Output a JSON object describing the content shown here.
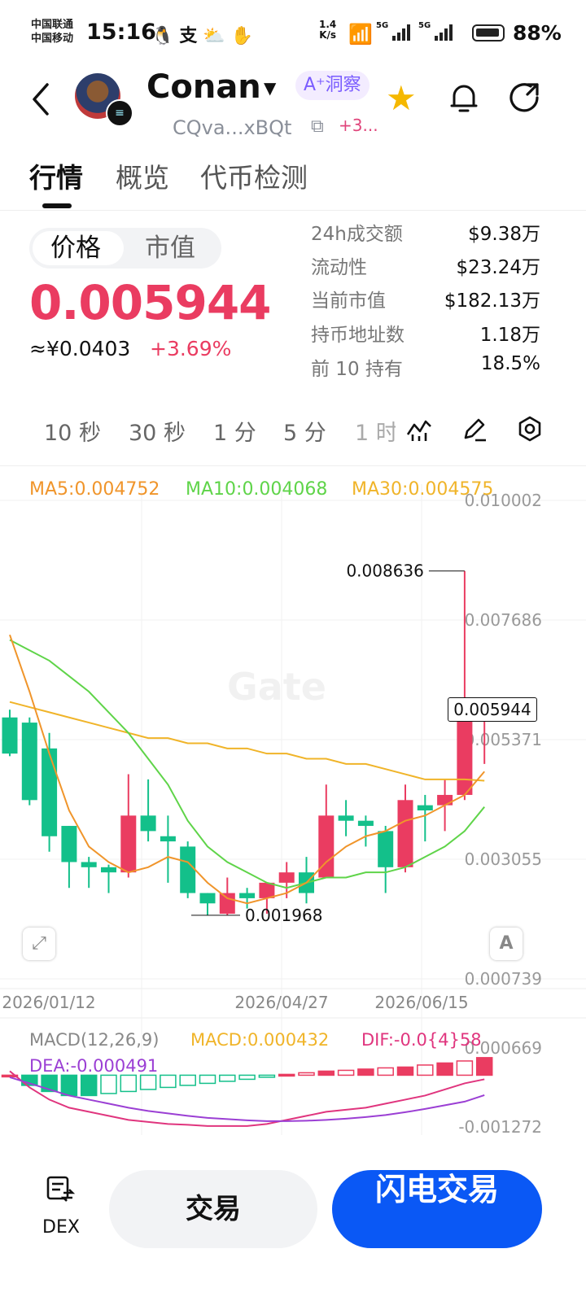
{
  "status_bar": {
    "carrier_1": "中国联通",
    "carrier_2": "中国移动",
    "time": "15:16",
    "speed_value": "1.4",
    "speed_unit": "K/s",
    "battery": "88%"
  },
  "header": {
    "coin_name": "Conan",
    "ai_tag": "A⁺洞察",
    "address": "CQva...xBQt",
    "more_tag": "+3..."
  },
  "tabs": [
    {
      "label": "行情"
    },
    {
      "label": "概览"
    },
    {
      "label": "代币检测"
    }
  ],
  "price_panel": {
    "toggle": [
      "价格",
      "市值"
    ],
    "price": "0.005944",
    "price_cny": "≈¥0.0403",
    "change": "+3.69%"
  },
  "stats": [
    {
      "label": "24h成交额",
      "value": "$9.38万"
    },
    {
      "label": "流动性",
      "value": "$23.24万"
    },
    {
      "label": "当前市值",
      "value": "$182.13万"
    },
    {
      "label": "持币地址数",
      "value": "1.18万"
    },
    {
      "label": "前 10 持有",
      "value": "18.5%"
    }
  ],
  "intervals": [
    "10 秒",
    "30 秒",
    "1 分",
    "5 分",
    "1 时"
  ],
  "chart_data": {
    "type": "candlestick",
    "ma_legend": {
      "ma5": "MA5:0.004752",
      "ma10": "MA10:0.004068",
      "ma30": "MA30:0.004575"
    },
    "y_ticks": [
      "0.010002",
      "0.007686",
      "0.005371",
      "0.003055",
      "0.000739"
    ],
    "ylim": [
      0.000739,
      0.010002
    ],
    "x_labels": [
      "2026/01/12",
      "2026/04/27",
      "2026/06/15"
    ],
    "current_price": "0.005944",
    "high_marker": "0.008636",
    "low_marker": "0.001968",
    "watermark": "Gate",
    "candles": [
      {
        "o": 0.0058,
        "h": 0.00595,
        "l": 0.00505,
        "c": 0.0051
      },
      {
        "o": 0.0057,
        "h": 0.0058,
        "l": 0.0041,
        "c": 0.0042
      },
      {
        "o": 0.0052,
        "h": 0.0055,
        "l": 0.0032,
        "c": 0.0035
      },
      {
        "o": 0.0037,
        "h": 0.0037,
        "l": 0.0025,
        "c": 0.003
      },
      {
        "o": 0.003,
        "h": 0.0031,
        "l": 0.0025,
        "c": 0.0029
      },
      {
        "o": 0.0029,
        "h": 0.00295,
        "l": 0.0024,
        "c": 0.0028
      },
      {
        "o": 0.0028,
        "h": 0.0047,
        "l": 0.0027,
        "c": 0.0039
      },
      {
        "o": 0.0039,
        "h": 0.0046,
        "l": 0.0034,
        "c": 0.0036
      },
      {
        "o": 0.0035,
        "h": 0.0039,
        "l": 0.0026,
        "c": 0.0034
      },
      {
        "o": 0.0033,
        "h": 0.0034,
        "l": 0.0023,
        "c": 0.0024
      },
      {
        "o": 0.0024,
        "h": 0.0024,
        "l": 0.00197,
        "c": 0.0022
      },
      {
        "o": 0.002,
        "h": 0.0027,
        "l": 0.00197,
        "c": 0.0024
      },
      {
        "o": 0.0024,
        "h": 0.0025,
        "l": 0.0021,
        "c": 0.0023
      },
      {
        "o": 0.0023,
        "h": 0.0026,
        "l": 0.002,
        "c": 0.0026
      },
      {
        "o": 0.0026,
        "h": 0.003,
        "l": 0.0023,
        "c": 0.0028
      },
      {
        "o": 0.0028,
        "h": 0.0031,
        "l": 0.0022,
        "c": 0.0024
      },
      {
        "o": 0.0027,
        "h": 0.0045,
        "l": 0.0027,
        "c": 0.0039
      },
      {
        "o": 0.0039,
        "h": 0.0042,
        "l": 0.0035,
        "c": 0.0038
      },
      {
        "o": 0.0038,
        "h": 0.0039,
        "l": 0.0033,
        "c": 0.0037
      },
      {
        "o": 0.0036,
        "h": 0.0037,
        "l": 0.0024,
        "c": 0.0029
      },
      {
        "o": 0.0029,
        "h": 0.0045,
        "l": 0.0028,
        "c": 0.0042
      },
      {
        "o": 0.0041,
        "h": 0.0043,
        "l": 0.0034,
        "c": 0.004
      },
      {
        "o": 0.0041,
        "h": 0.0046,
        "l": 0.0036,
        "c": 0.0043
      },
      {
        "o": 0.0043,
        "h": 0.008636,
        "l": 0.0042,
        "c": 0.0058
      },
      {
        "o": 0.0058,
        "h": 0.006,
        "l": 0.0049,
        "c": 0.005944
      }
    ],
    "ma30": [
      0.0061,
      0.006,
      0.0059,
      0.0058,
      0.0057,
      0.0056,
      0.0055,
      0.0054,
      0.0054,
      0.0053,
      0.0053,
      0.0052,
      0.0052,
      0.0051,
      0.0051,
      0.005,
      0.005,
      0.0049,
      0.0049,
      0.0048,
      0.0047,
      0.0046,
      0.0046,
      0.0046,
      0.004575
    ],
    "ma10": [
      0.0073,
      0.0071,
      0.0069,
      0.0066,
      0.0063,
      0.0059,
      0.0055,
      0.005,
      0.0045,
      0.0038,
      0.0033,
      0.003,
      0.0028,
      0.0026,
      0.0025,
      0.0026,
      0.0027,
      0.0027,
      0.0028,
      0.0028,
      0.0029,
      0.0031,
      0.0033,
      0.0036,
      0.004068
    ],
    "ma5": [
      0.0074,
      0.0063,
      0.0051,
      0.004,
      0.0033,
      0.003,
      0.0028,
      0.0029,
      0.0031,
      0.003,
      0.0026,
      0.0023,
      0.0022,
      0.0023,
      0.0024,
      0.0026,
      0.003,
      0.0033,
      0.0035,
      0.0036,
      0.0038,
      0.0039,
      0.0041,
      0.0043,
      0.004752
    ],
    "macd": {
      "legend": {
        "params": "MACD(12,26,9)",
        "macd": "MACD:0.000432",
        "dif": "DIF:-0.0{4}58",
        "dea": "DEA:-0.000491"
      },
      "y_ticks": [
        "0.000669",
        "-0.001272"
      ],
      "ylim": [
        -0.001272,
        0.000669
      ],
      "hist": [
        0.0,
        -0.00025,
        -0.0004,
        -0.0005,
        -0.0005,
        -0.00045,
        -0.0004,
        -0.00035,
        -0.0003,
        -0.00025,
        -0.0002,
        -0.00015,
        -0.0001,
        -5e-05,
        2e-05,
        6e-05,
        0.0001,
        0.00012,
        0.00015,
        0.00018,
        0.0002,
        0.00025,
        0.0003,
        0.00035,
        0.000432
      ],
      "dif": [
        0.0001,
        -0.0003,
        -0.0006,
        -0.0008,
        -0.0009,
        -0.001,
        -0.0011,
        -0.00115,
        -0.0012,
        -0.00122,
        -0.00125,
        -0.00125,
        -0.00125,
        -0.0012,
        -0.0011,
        -0.001,
        -0.0009,
        -0.00085,
        -0.0008,
        -0.0007,
        -0.0006,
        -0.0005,
        -0.00035,
        -0.0002,
        -0.0001
      ],
      "dea": [
        -5e-05,
        -0.0002,
        -0.00035,
        -0.0005,
        -0.0006,
        -0.0007,
        -0.0008,
        -0.00088,
        -0.00094,
        -0.001,
        -0.00105,
        -0.00108,
        -0.00111,
        -0.00113,
        -0.00113,
        -0.00112,
        -0.0011,
        -0.00107,
        -0.00103,
        -0.00098,
        -0.00091,
        -0.00083,
        -0.00074,
        -0.00065,
        -0.000491
      ]
    }
  },
  "bottom_bar": {
    "dex_label": "DEX",
    "trade_label": "交易",
    "flash_label": "闪电交易"
  },
  "colors": {
    "up": "#ea3c61",
    "down": "#13c08a",
    "ma5": "#f0952b",
    "ma10": "#5fd449",
    "ma30": "#f0b429",
    "dif": "#e0357e",
    "dea": "#9b3fd4",
    "accent": "#0a58f5"
  }
}
